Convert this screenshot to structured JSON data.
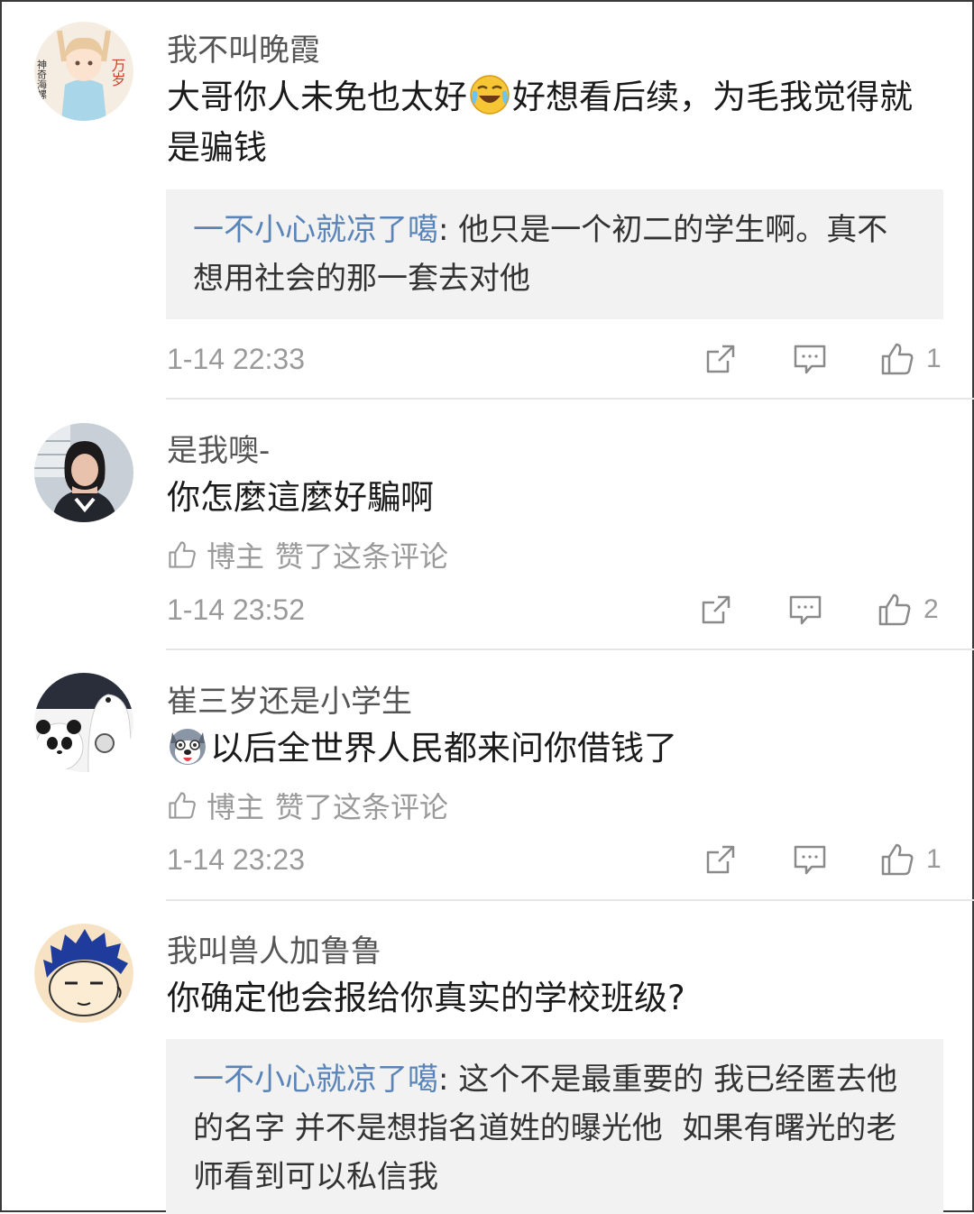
{
  "comments": [
    {
      "username": "我不叫晚霞",
      "avatar_icon": "anime-girl-avatar",
      "avatar_text": [
        "神奇海螺",
        "万岁"
      ],
      "text_before": "大哥你人未免也太好",
      "emoji": "crying-laugh-emoji",
      "text_after": "好想看后续，为毛我觉得就是骗钱",
      "reply": {
        "author": "一不小心就凉了噶",
        "separator": ": ",
        "text": "他只是一个初二的学生啊。真不想用社会的那一套去对他"
      },
      "time": "1-14 22:33",
      "likes": "1"
    },
    {
      "username": "是我噢-",
      "avatar_icon": "girl-photo-avatar",
      "text": "你怎麼這麼好騙啊",
      "liked_by": {
        "label": "博主",
        "text": "赞了这条评论"
      },
      "time": "1-14 23:52",
      "likes": "2"
    },
    {
      "username": "崔三岁还是小学生",
      "avatar_icon": "bears-avatar",
      "emoji": "husky-emoji",
      "text": "以后全世界人民都来问你借钱了",
      "liked_by": {
        "label": "博主",
        "text": "赞了这条评论"
      },
      "time": "1-14 23:23",
      "likes": "1"
    },
    {
      "username": "我叫兽人加鲁鲁",
      "avatar_icon": "cartoon-boy-avatar",
      "text": "你确定他会报给你真实的学校班级?",
      "reply": {
        "author": "一不小心就凉了噶",
        "separator": ": ",
        "text": "这个不是最重要的 我已经匿去他的名字 并不是想指名道姓的曝光他  如果有曙光的老师看到可以私信我"
      }
    }
  ],
  "colors": {
    "reply_author": "#5a84b8",
    "secondary_text": "#9a9a9a",
    "reply_background": "#f2f2f2",
    "icon_gray": "#8a8a8a"
  }
}
